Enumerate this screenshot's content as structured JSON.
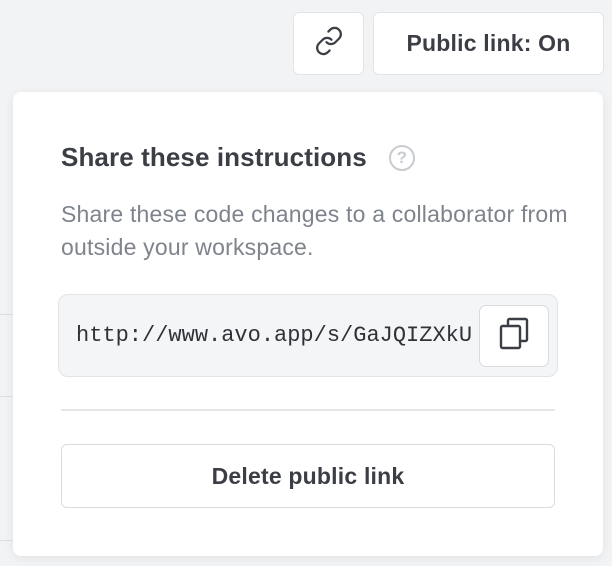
{
  "toolbar": {
    "link_icon": "link-icon",
    "public_link_label": "Public link: On"
  },
  "popover": {
    "title": "Share these instructions",
    "help_icon": "question-circle-icon",
    "help_glyph": "?",
    "description": "Share these code changes to a collaborator from outside your workspace.",
    "url": "http://www.avo.app/s/GaJQIZXkU",
    "copy_icon": "copy-icon",
    "delete_label": "Delete public link"
  },
  "colors": {
    "background": "#f2f3f5",
    "surface": "#ffffff",
    "text_primary": "#3b3e45",
    "text_secondary": "#7e838c",
    "border": "#e2e4e8",
    "url_field_bg": "#f4f5f7"
  }
}
